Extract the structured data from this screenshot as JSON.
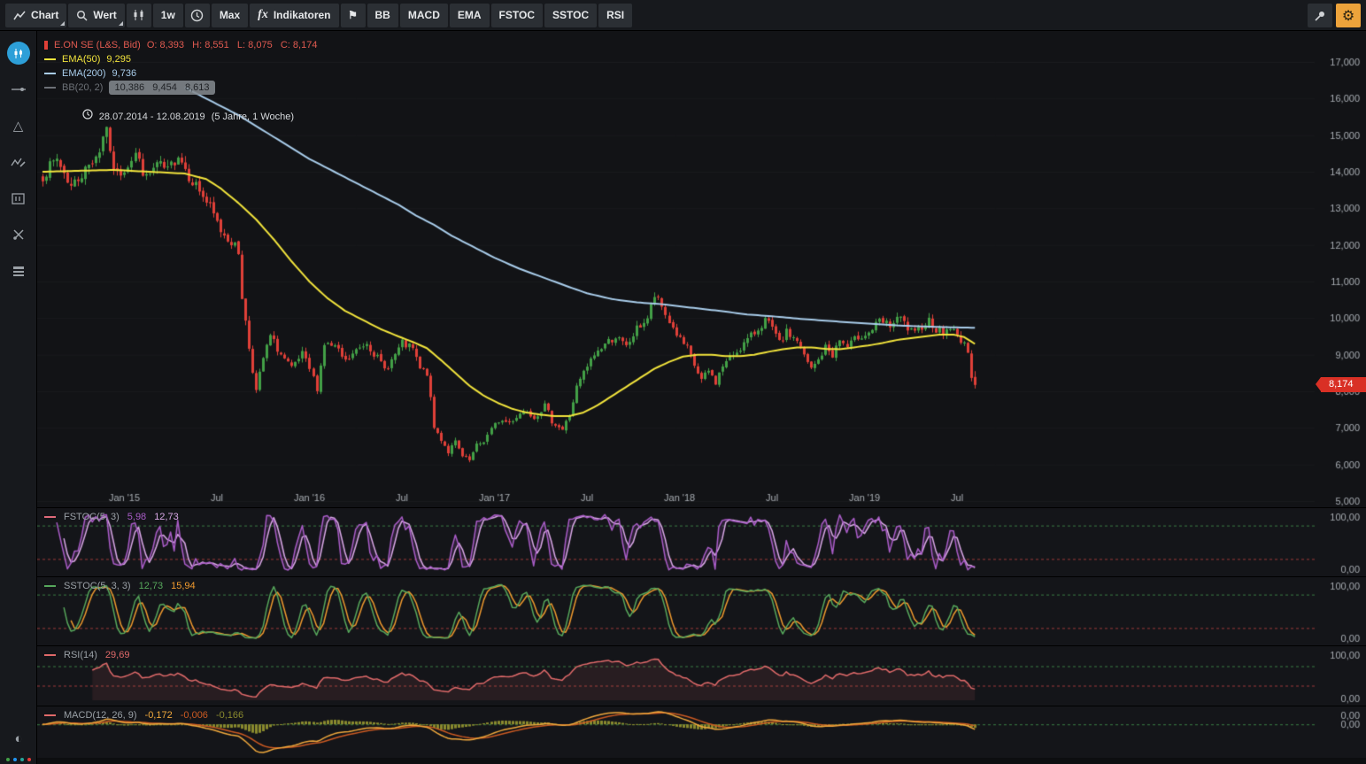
{
  "colors": {
    "bg": "#121316",
    "panel_bg": "#141519",
    "axis_text": "#a8adb3",
    "grid": "rgba(255,255,255,0.035)",
    "up": "#43a047",
    "down": "#e04038",
    "ema50": "#f2e43c",
    "ema200": "#a9cdeb",
    "ohlc_text": "#e05a50",
    "range_text": "#d6d9dc",
    "bb_text": "#7d8288",
    "fstoc_k": "#a95cc7",
    "fstoc_d": "#d9a8e6",
    "fstoc_fill": "rgba(170,90,200,0.16)",
    "sstoc_k": "#57a85c",
    "sstoc_d": "#f09a2e",
    "rsi": "#e06a6a",
    "rsi_fill": "rgba(224,106,106,0.10)",
    "macd_line": "#f0a83c",
    "macd_signal": "#cc5a22",
    "macd_hist": "#8a8a2e",
    "level_hi": "#3a7d44",
    "level_lo": "#9e3a3a",
    "price_tag_bg": "#d93025",
    "gear_bg": "#eda33b",
    "accent_blue": "#2d9fd8",
    "status_dots": [
      "#43a047",
      "#2196f3",
      "#26a69a",
      "#e53935"
    ]
  },
  "icons": {
    "gear": "⚙",
    "flag": "⚑",
    "shapes": "△",
    "contrast": "◐"
  },
  "toolbar": {
    "chart": "Chart",
    "search": "Wert",
    "interval": "1w",
    "range": "Max",
    "fx": "fx",
    "indicators": "Indikatoren",
    "quick": [
      "BB",
      "MACD",
      "EMA",
      "FSTOC",
      "SSTOC",
      "RSI"
    ]
  },
  "legend": {
    "instrument": "E.ON SE (L&S, Bid)",
    "ohlc": "O: 8,393   H: 8,551   L: 8,075   C: 8,174",
    "ema50_label": "EMA(50)",
    "ema50_value": "9,295",
    "ema200_label": "EMA(200)",
    "ema200_value": "9,736",
    "bb_label": "BB(20, 2)",
    "bb_values": "10,386   9,454   8,613",
    "range_text": "28.07.2014 - 12.08.2019",
    "range_note": "(5 Jahre, 1 Woche)"
  },
  "panels": [
    {
      "id": "fstoc",
      "canvas": "fstoc-canvas",
      "label": "FSTOC(5, 3)",
      "values": [
        "5,98",
        "12,73"
      ],
      "value_colors": [
        "fstoc_k",
        "fstoc_d"
      ],
      "axis": [
        "100,00",
        "0,00"
      ],
      "levels": {
        "hi": 80,
        "lo": 20
      },
      "swatch": "#e06a7a"
    },
    {
      "id": "sstoc",
      "canvas": "sstoc-canvas",
      "label": "SSTOC(5, 3, 3)",
      "values": [
        "12,73",
        "15,94"
      ],
      "value_colors": [
        "sstoc_k",
        "sstoc_d"
      ],
      "axis": [
        "100,00",
        "0,00"
      ],
      "levels": {
        "hi": 80,
        "lo": 20
      },
      "swatch": "#57a85c"
    },
    {
      "id": "rsi",
      "canvas": "rsi-canvas",
      "label": "RSI(14)",
      "values": [
        "29,69"
      ],
      "value_colors": [
        "rsi"
      ],
      "axis": [
        "100,00",
        "0,00"
      ],
      "levels": {
        "hi": 70,
        "lo": 30
      },
      "swatch": "#e06a6a"
    },
    {
      "id": "macd",
      "canvas": "macd-canvas",
      "label": "MACD(12, 26, 9)",
      "values": [
        "-0,172",
        "-0,006",
        "-0,166"
      ],
      "value_colors": [
        "macd_line",
        "macd_signal",
        "macd_hist"
      ],
      "axis": [
        "0,00",
        "0,00"
      ],
      "levels": {
        "zero": 0
      },
      "swatch": "#e06a6a"
    }
  ],
  "chart_data": {
    "type": "candlestick",
    "title": "E.ON SE (L&S, Bid), 1 week candles, 28.07.2014 - 12.08.2019, with EMA(50), EMA(200) overlays and FSTOC / SSTOC / RSI / MACD sub-panels",
    "weeks": 263,
    "noise_seed": 7,
    "close_noise": 0.012,
    "wick_noise": 0.013,
    "price_axis": {
      "min": 5,
      "max": 17,
      "step": 1,
      "tick_labels": [
        "17,000",
        "16,000",
        "15,000",
        "14,000",
        "13,000",
        "12,000",
        "11,000",
        "10,000",
        "9,000",
        "8,000",
        "7,000",
        "6,000",
        "5,000"
      ]
    },
    "x_ticks": [
      {
        "label": "Jan '15",
        "week": 23
      },
      {
        "label": "Jul",
        "week": 49
      },
      {
        "label": "Jan '16",
        "week": 75
      },
      {
        "label": "Jul",
        "week": 101
      },
      {
        "label": "Jan '17",
        "week": 127
      },
      {
        "label": "Jul",
        "week": 153
      },
      {
        "label": "Jan '18",
        "week": 179
      },
      {
        "label": "Jul",
        "week": 205
      },
      {
        "label": "Jan '19",
        "week": 231
      },
      {
        "label": "Jul",
        "week": 257
      }
    ],
    "close_anchors": [
      [
        0,
        13.9
      ],
      [
        4,
        14.35
      ],
      [
        8,
        13.6
      ],
      [
        12,
        14.05
      ],
      [
        16,
        14.6
      ],
      [
        18,
        15.3
      ],
      [
        19,
        14.4
      ],
      [
        21,
        13.9
      ],
      [
        23,
        14.1
      ],
      [
        26,
        14.5
      ],
      [
        29,
        13.8
      ],
      [
        32,
        14.2
      ],
      [
        35,
        14.0
      ],
      [
        38,
        14.5
      ],
      [
        41,
        13.9
      ],
      [
        44,
        13.5
      ],
      [
        47,
        13.0
      ],
      [
        50,
        12.4
      ],
      [
        53,
        12.1
      ],
      [
        55,
        11.8
      ],
      [
        56,
        10.6
      ],
      [
        58,
        9.2
      ],
      [
        60,
        8.0
      ],
      [
        62,
        8.9
      ],
      [
        64,
        9.5
      ],
      [
        67,
        9.0
      ],
      [
        70,
        8.6
      ],
      [
        73,
        9.0
      ],
      [
        75,
        8.6
      ],
      [
        77,
        8.1
      ],
      [
        79,
        9.3
      ],
      [
        82,
        9.2
      ],
      [
        85,
        8.8
      ],
      [
        88,
        9.1
      ],
      [
        91,
        9.35
      ],
      [
        94,
        8.9
      ],
      [
        96,
        8.6
      ],
      [
        98,
        8.85
      ],
      [
        101,
        9.3
      ],
      [
        104,
        9.15
      ],
      [
        106,
        8.6
      ],
      [
        108,
        8.5
      ],
      [
        110,
        7.0
      ],
      [
        112,
        6.7
      ],
      [
        114,
        6.35
      ],
      [
        116,
        6.6
      ],
      [
        118,
        6.2
      ],
      [
        120,
        6.1
      ],
      [
        122,
        6.5
      ],
      [
        124,
        6.65
      ],
      [
        126,
        6.95
      ],
      [
        128,
        7.2
      ],
      [
        131,
        7.15
      ],
      [
        134,
        7.4
      ],
      [
        136,
        7.5
      ],
      [
        138,
        7.3
      ],
      [
        141,
        7.6
      ],
      [
        143,
        7.2
      ],
      [
        146,
        6.95
      ],
      [
        148,
        7.35
      ],
      [
        150,
        8.1
      ],
      [
        152,
        8.5
      ],
      [
        155,
        9.0
      ],
      [
        158,
        9.3
      ],
      [
        161,
        9.5
      ],
      [
        164,
        9.2
      ],
      [
        167,
        9.7
      ],
      [
        170,
        10.0
      ],
      [
        172,
        10.6
      ],
      [
        174,
        10.3
      ],
      [
        176,
        9.9
      ],
      [
        179,
        9.4
      ],
      [
        181,
        9.15
      ],
      [
        183,
        8.7
      ],
      [
        185,
        8.3
      ],
      [
        187,
        8.55
      ],
      [
        189,
        8.25
      ],
      [
        191,
        8.7
      ],
      [
        194,
        9.0
      ],
      [
        197,
        9.3
      ],
      [
        200,
        9.6
      ],
      [
        203,
        9.95
      ],
      [
        205,
        9.7
      ],
      [
        207,
        9.3
      ],
      [
        209,
        9.6
      ],
      [
        212,
        9.4
      ],
      [
        214,
        8.95
      ],
      [
        216,
        8.6
      ],
      [
        218,
        8.85
      ],
      [
        220,
        9.2
      ],
      [
        222,
        9.0
      ],
      [
        224,
        9.4
      ],
      [
        226,
        9.2
      ],
      [
        229,
        9.5
      ],
      [
        232,
        9.6
      ],
      [
        235,
        9.9
      ],
      [
        238,
        9.8
      ],
      [
        241,
        10.0
      ],
      [
        243,
        9.7
      ],
      [
        245,
        9.55
      ],
      [
        247,
        9.8
      ],
      [
        249,
        9.95
      ],
      [
        251,
        9.7
      ],
      [
        253,
        9.6
      ],
      [
        255,
        9.75
      ],
      [
        257,
        9.5
      ],
      [
        259,
        9.35
      ],
      [
        260,
        8.95
      ],
      [
        261,
        8.45
      ],
      [
        262,
        8.174
      ]
    ],
    "ema50_anchors": [
      [
        0,
        14.0
      ],
      [
        20,
        14.05
      ],
      [
        40,
        13.95
      ],
      [
        46,
        13.8
      ],
      [
        50,
        13.55
      ],
      [
        55,
        13.15
      ],
      [
        60,
        12.7
      ],
      [
        65,
        12.15
      ],
      [
        70,
        11.55
      ],
      [
        75,
        11.0
      ],
      [
        80,
        10.55
      ],
      [
        85,
        10.2
      ],
      [
        90,
        9.95
      ],
      [
        95,
        9.7
      ],
      [
        100,
        9.5
      ],
      [
        104,
        9.35
      ],
      [
        108,
        9.18
      ],
      [
        112,
        8.85
      ],
      [
        116,
        8.5
      ],
      [
        120,
        8.15
      ],
      [
        124,
        7.88
      ],
      [
        128,
        7.68
      ],
      [
        132,
        7.52
      ],
      [
        136,
        7.42
      ],
      [
        140,
        7.36
      ],
      [
        144,
        7.32
      ],
      [
        148,
        7.32
      ],
      [
        152,
        7.42
      ],
      [
        156,
        7.62
      ],
      [
        160,
        7.87
      ],
      [
        164,
        8.12
      ],
      [
        168,
        8.37
      ],
      [
        172,
        8.62
      ],
      [
        176,
        8.8
      ],
      [
        180,
        8.95
      ],
      [
        184,
        9.0
      ],
      [
        188,
        9.0
      ],
      [
        192,
        8.96
      ],
      [
        196,
        8.96
      ],
      [
        200,
        9.0
      ],
      [
        204,
        9.08
      ],
      [
        208,
        9.15
      ],
      [
        212,
        9.2
      ],
      [
        216,
        9.2
      ],
      [
        220,
        9.16
      ],
      [
        224,
        9.15
      ],
      [
        228,
        9.2
      ],
      [
        232,
        9.25
      ],
      [
        236,
        9.32
      ],
      [
        240,
        9.4
      ],
      [
        244,
        9.45
      ],
      [
        248,
        9.5
      ],
      [
        252,
        9.55
      ],
      [
        256,
        9.55
      ],
      [
        259,
        9.48
      ],
      [
        262,
        9.295
      ]
    ],
    "ema200_anchors": [
      [
        40,
        16.3
      ],
      [
        46,
        16.0
      ],
      [
        50,
        15.8
      ],
      [
        55,
        15.55
      ],
      [
        60,
        15.25
      ],
      [
        65,
        14.95
      ],
      [
        70,
        14.65
      ],
      [
        75,
        14.35
      ],
      [
        80,
        14.1
      ],
      [
        85,
        13.85
      ],
      [
        90,
        13.6
      ],
      [
        95,
        13.35
      ],
      [
        100,
        13.1
      ],
      [
        105,
        12.8
      ],
      [
        110,
        12.55
      ],
      [
        115,
        12.25
      ],
      [
        120,
        12.0
      ],
      [
        127,
        11.65
      ],
      [
        134,
        11.35
      ],
      [
        141,
        11.1
      ],
      [
        148,
        10.85
      ],
      [
        153,
        10.68
      ],
      [
        160,
        10.52
      ],
      [
        167,
        10.43
      ],
      [
        174,
        10.38
      ],
      [
        181,
        10.3
      ],
      [
        190,
        10.2
      ],
      [
        198,
        10.1
      ],
      [
        205,
        10.05
      ],
      [
        213,
        9.98
      ],
      [
        220,
        9.93
      ],
      [
        227,
        9.88
      ],
      [
        232,
        9.85
      ],
      [
        240,
        9.8
      ],
      [
        248,
        9.77
      ],
      [
        255,
        9.75
      ],
      [
        262,
        9.736
      ]
    ],
    "last_candle": {
      "o": 8.393,
      "h": 8.551,
      "l": 8.075,
      "c": 8.174
    },
    "last_price_label": "8,174"
  }
}
